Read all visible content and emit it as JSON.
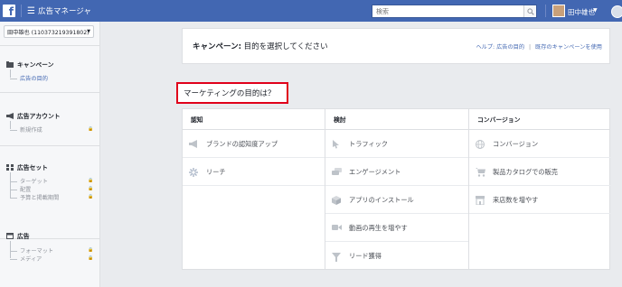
{
  "topbar": {
    "logo": "f",
    "menu_icon": "hamburger-icon",
    "app_title": "広告マネージャ",
    "search_placeholder": "検索",
    "user_name": "田中雄也",
    "caret": "▼"
  },
  "sidebar": {
    "account": "田中雄也 (110373219391802)",
    "sections": [
      {
        "name": "キャンペーン",
        "icon": "campaign-icon",
        "items": [
          {
            "label": "広告の目的",
            "active": true,
            "locked": false
          }
        ]
      },
      {
        "name": "広告アカウント",
        "icon": "megaphone-icon",
        "items": [
          {
            "label": "新規作成",
            "active": false,
            "locked": true
          }
        ]
      },
      {
        "name": "広告セット",
        "icon": "adset-grid-icon",
        "items": [
          {
            "label": "ターゲット",
            "active": false,
            "locked": true
          },
          {
            "label": "配置",
            "active": false,
            "locked": true
          },
          {
            "label": "予算と掲載期間",
            "active": false,
            "locked": true
          }
        ]
      },
      {
        "name": "広告",
        "icon": "ad-square-icon",
        "items": [
          {
            "label": "フォーマット",
            "active": false,
            "locked": true
          },
          {
            "label": "メディア",
            "active": false,
            "locked": true
          }
        ]
      }
    ]
  },
  "header": {
    "title_bold": "キャンペーン:",
    "title_rest": " 目的を選択してください",
    "links": [
      "ヘルプ: 広告の目的",
      "既存のキャンペーンを使用"
    ]
  },
  "objective_label": "マーケティングの目的は？",
  "columns": [
    {
      "title": "認知",
      "items": [
        {
          "label": "ブランドの認知度アップ",
          "icon": "megaphone-icon"
        },
        {
          "label": "リーチ",
          "icon": "reach-burst-icon"
        }
      ]
    },
    {
      "title": "検討",
      "items": [
        {
          "label": "トラフィック",
          "icon": "cursor-icon"
        },
        {
          "label": "エンゲージメント",
          "icon": "chat-bubbles-icon"
        },
        {
          "label": "アプリのインストール",
          "icon": "cube-icon"
        },
        {
          "label": "動画の再生を増やす",
          "icon": "video-camera-icon"
        },
        {
          "label": "リード獲得",
          "icon": "funnel-icon"
        }
      ]
    },
    {
      "title": "コンバージョン",
      "items": [
        {
          "label": "コンバージョン",
          "icon": "globe-icon"
        },
        {
          "label": "製品カタログでの販売",
          "icon": "cart-icon"
        },
        {
          "label": "来店数を増やす",
          "icon": "store-icon"
        }
      ]
    }
  ],
  "colors": {
    "brand_blue": "#4267b2",
    "highlight_red": "#e0001a",
    "icon_gray": "#bec3c9"
  }
}
